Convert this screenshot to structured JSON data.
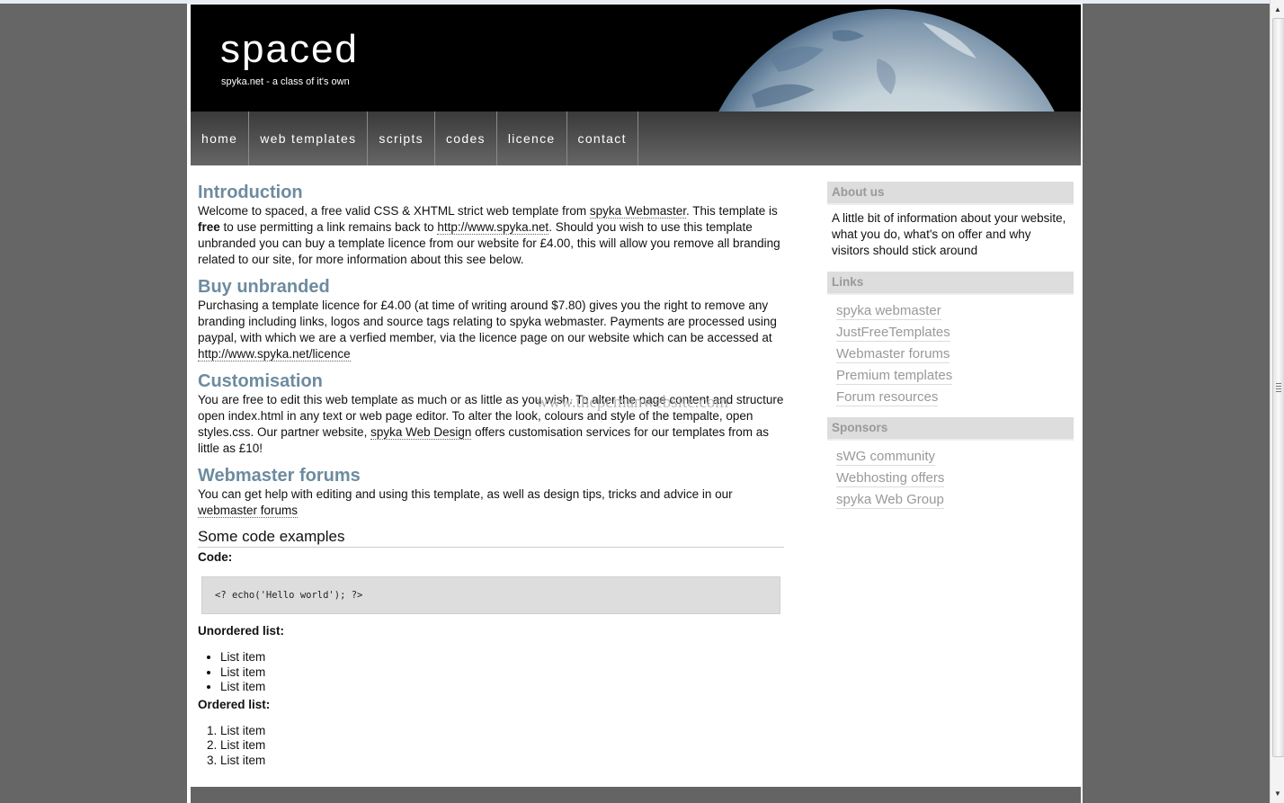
{
  "header": {
    "title": "spaced",
    "subtitle": "spyka.net - a class of it's own"
  },
  "menu": [
    {
      "label": "home"
    },
    {
      "label": "web templates"
    },
    {
      "label": "scripts"
    },
    {
      "label": "codes"
    },
    {
      "label": "licence"
    },
    {
      "label": "contact"
    }
  ],
  "main": {
    "intro": {
      "heading": "Introduction",
      "t1": "Welcome to spaced, a free valid CSS & XHTML strict web template from ",
      "link1": "spyka Webmaster",
      "t2": ". This template is ",
      "bold": "free",
      "t3": " to use permitting a link remains back to ",
      "link2": "http://www.spyka.net",
      "t4": ". Should you wish to use this template unbranded you can buy a template licence from our website for £4.00, this will allow you remove all branding related to our site, for more information about this see below."
    },
    "buy": {
      "heading": "Buy unbranded",
      "t1": "Purchasing a template licence for £4.00 (at time of writing around $7.80) gives you the right to remove any branding including links, logos and source tags relating to spyka webmaster. Payments are processed using paypal, with which we are a verfied member, via the licence page on our website which can be accessed at ",
      "link1": "http://www.spyka.net/licence"
    },
    "custom": {
      "heading": "Customisation",
      "t1": "You are free to edit this web template as much or as little as you wish. To alter the page content and structure open index.html in any text or web page editor. To alter the look, colours and style of the tempalte, open styles.css. Our partner website, ",
      "link1": "spyka Web Design",
      "t2": " offers customisation services for our templates from as little as £10!"
    },
    "forums": {
      "heading": "Webmaster forums",
      "t1": "You can get help with editing and using this template, as well as design tips, tricks and advice in our ",
      "link1": "webmaster forums"
    },
    "examples": {
      "heading": "Some code examples",
      "code_label": "Code:",
      "code": "<? echo('Hello world'); ?>",
      "ul_label": "Unordered list:",
      "ul_items": [
        "List item",
        "List item",
        "List item"
      ],
      "ol_label": "Ordered list:",
      "ol_items": [
        "List item",
        "List item",
        "List item"
      ]
    }
  },
  "sidebar": {
    "about": {
      "heading": "About us",
      "text": "A little bit of information about your website, what you do, what's on offer and why visitors should stick around"
    },
    "links": {
      "heading": "Links",
      "items": [
        "spyka webmaster",
        "JustFreeTemplates",
        "Webmaster forums",
        "Premium templates",
        "Forum resources"
      ]
    },
    "sponsors": {
      "heading": "Sponsors",
      "items": [
        "sWG community",
        "Webhosting offers",
        "spyka Web Group"
      ]
    }
  },
  "watermark": "www.thepcmanwebsite.com",
  "colors": {
    "heading_accent": "#6d8ba0",
    "page_bg": "#666666",
    "sidebar_head_bg": "#dddddd"
  }
}
